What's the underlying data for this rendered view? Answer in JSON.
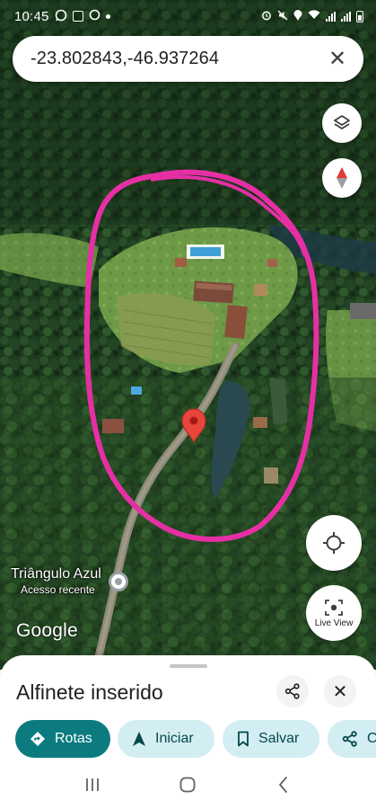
{
  "status_bar": {
    "time": "10:45",
    "left_icons": [
      "whatsapp-icon",
      "app-notification-icon",
      "app-notification-icon",
      "dot-icon"
    ],
    "right_icons": [
      "alarm-icon",
      "mute-icon",
      "location-icon",
      "wifi-icon",
      "signal-icon",
      "signal-icon",
      "battery-icon"
    ]
  },
  "search": {
    "query": "-23.802843,-46.937264",
    "clear_icon": "close-icon"
  },
  "map": {
    "type": "satellite",
    "annotation_color": "#e62fa4",
    "pin_color": "#e8453c",
    "place_label": {
      "name": "Triângulo Azul",
      "subtitle": "Acesso recente"
    },
    "logo": "Google",
    "buttons": {
      "layers": "layers-icon",
      "compass": "compass-icon",
      "my_location": "my-location-icon",
      "live_view": "Live View"
    }
  },
  "sheet": {
    "title": "Alfinete inserido",
    "share_icon": "share-icon",
    "close_icon": "close-icon",
    "actions": [
      {
        "label": "Rotas",
        "icon": "directions-icon"
      },
      {
        "label": "Iniciar",
        "icon": "navigation-arrow-icon"
      },
      {
        "label": "Salvar",
        "icon": "bookmark-icon"
      },
      {
        "label": "C",
        "icon": "share-icon"
      }
    ]
  },
  "nav_bar": [
    "recent-apps-icon",
    "home-icon",
    "back-icon"
  ],
  "colors": {
    "accent": "#0b7b80",
    "chip_bg": "#d3eef2",
    "chip_text": "#04484c"
  }
}
